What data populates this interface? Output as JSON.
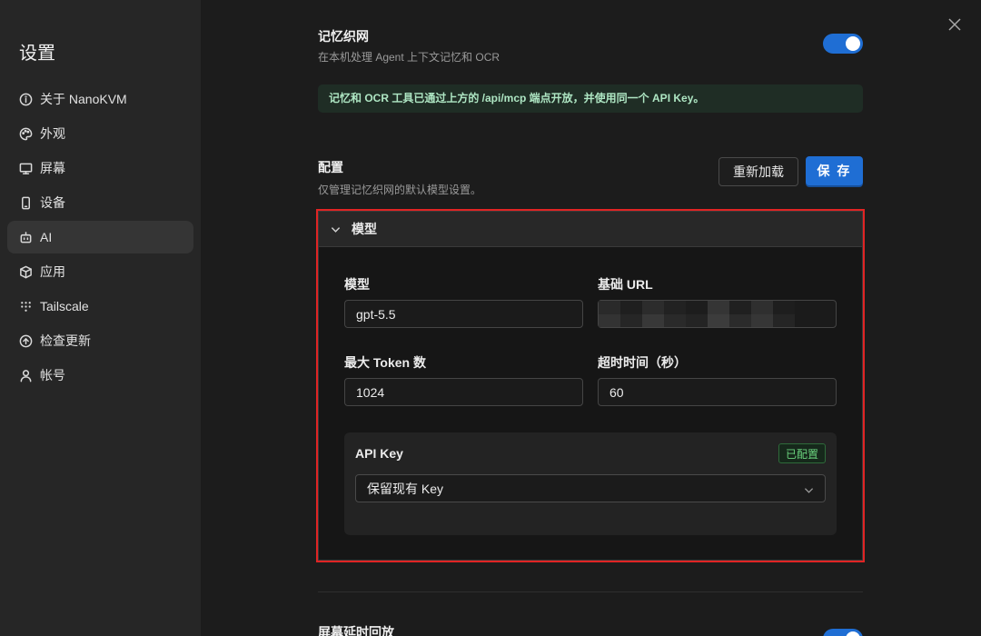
{
  "sidebar": {
    "title": "设置",
    "items": [
      {
        "label": "关于 NanoKVM",
        "icon": "info-icon",
        "active": false
      },
      {
        "label": "外观",
        "icon": "palette-icon",
        "active": false
      },
      {
        "label": "屏幕",
        "icon": "monitor-icon",
        "active": false
      },
      {
        "label": "设备",
        "icon": "device-icon",
        "active": false
      },
      {
        "label": "AI",
        "icon": "bot-icon",
        "active": true
      },
      {
        "label": "应用",
        "icon": "package-icon",
        "active": false
      },
      {
        "label": "Tailscale",
        "icon": "grid-dots-icon",
        "active": false
      },
      {
        "label": "检查更新",
        "icon": "arrow-up-circle-icon",
        "active": false
      },
      {
        "label": "帐号",
        "icon": "user-icon",
        "active": false
      }
    ]
  },
  "memory": {
    "title": "记忆织网",
    "description": "在本机处理 Agent 上下文记忆和 OCR",
    "enabled": true,
    "notice": "记忆和 OCR 工具已通过上方的 /api/mcp 端点开放，并使用同一个 API Key。"
  },
  "config": {
    "title": "配置",
    "description": "仅管理记忆织网的默认模型设置。",
    "reload_label": "重新加载",
    "save_label": "保 存"
  },
  "model_panel": {
    "header": "模型",
    "expanded": true,
    "fields": {
      "model_label": "模型",
      "model_value": "gpt-5.5",
      "base_url_label": "基础 URL",
      "base_url_value": "",
      "max_tokens_label": "最大 Token 数",
      "max_tokens_value": "1024",
      "timeout_label": "超时时间（秒）",
      "timeout_value": "60"
    },
    "api_key": {
      "label": "API Key",
      "status_badge": "已配置",
      "select_value": "保留现有 Key"
    }
  },
  "next_section": {
    "title": "屏幕延时回放",
    "enabled": true
  },
  "colors": {
    "accent": "#1f6ed4",
    "highlight_border": "#e02424",
    "success": "#6ad27d"
  }
}
